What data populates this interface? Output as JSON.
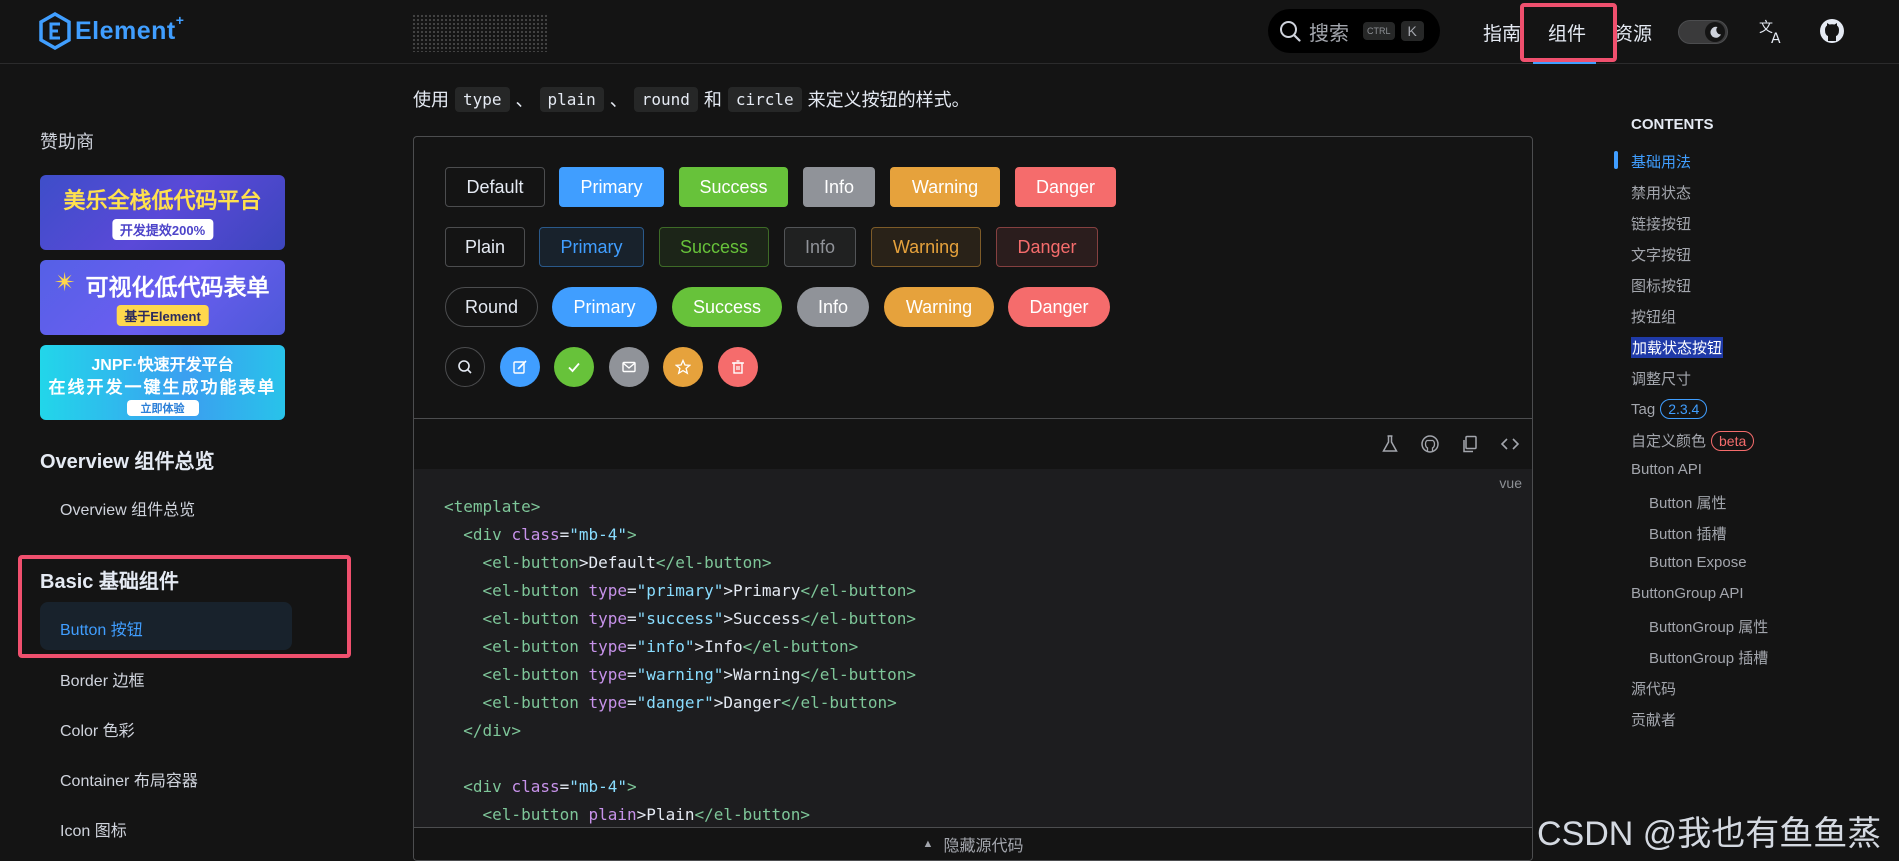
{
  "header": {
    "logo_text": "Element",
    "logo_sup": "+",
    "search_placeholder": "搜索",
    "search_kbd1": "CTRL",
    "search_kbd2": "K",
    "nav": [
      "指南",
      "组件",
      "资源"
    ]
  },
  "sidebar": {
    "sponsor_title": "赞助商",
    "ads": [
      {
        "main": "美乐全栈低代码平台",
        "pill": "开发提效200%"
      },
      {
        "main": "可视化低代码表单",
        "pill": "基于Element"
      },
      {
        "main": "JNPF·快速开发平台",
        "sub": "在线开发一键生成功能表单",
        "pill": "立即体验"
      }
    ],
    "group_overview": "Overview 组件总览",
    "link_overview": "Overview 组件总览",
    "group_basic": "Basic 基础组件",
    "links": [
      "Button 按钮",
      "Border 边框",
      "Color 色彩",
      "Container 布局容器",
      "Icon 图标"
    ]
  },
  "main": {
    "desc": {
      "prefix": "使用",
      "codes": [
        "type",
        "plain",
        "round",
        "circle"
      ],
      "sep": "、",
      "and": "和",
      "suffix": "来定义按钮的样式。"
    },
    "row1": [
      "Default",
      "Primary",
      "Success",
      "Info",
      "Warning",
      "Danger"
    ],
    "row2": [
      "Plain",
      "Primary",
      "Success",
      "Info",
      "Warning",
      "Danger"
    ],
    "row3": [
      "Round",
      "Primary",
      "Success",
      "Info",
      "Warning",
      "Danger"
    ],
    "circle_icons": [
      "search-icon",
      "edit-icon",
      "check-icon",
      "message-icon",
      "star-icon",
      "delete-icon"
    ],
    "toolbar_icons": [
      "flask-icon",
      "github-icon",
      "copy-icon",
      "code-icon"
    ],
    "code_lang": "vue",
    "code_lines": [
      [
        [
          "tg",
          "<template>"
        ]
      ],
      [
        [
          "",
          "  "
        ],
        [
          "tg",
          "<div "
        ],
        [
          "an",
          "class"
        ],
        [
          "",
          "="
        ],
        [
          "av",
          "\"mb-4\""
        ],
        [
          "tg",
          ">"
        ]
      ],
      [
        [
          "",
          "    "
        ],
        [
          "tg",
          "<el-button"
        ],
        [
          "",
          ">Default"
        ],
        [
          "tg",
          "</el-button>"
        ]
      ],
      [
        [
          "",
          "    "
        ],
        [
          "tg",
          "<el-button "
        ],
        [
          "an",
          "type"
        ],
        [
          "",
          "="
        ],
        [
          "av",
          "\"primary\""
        ],
        [
          "",
          ">Primary"
        ],
        [
          "tg",
          "</el-button>"
        ]
      ],
      [
        [
          "",
          "    "
        ],
        [
          "tg",
          "<el-button "
        ],
        [
          "an",
          "type"
        ],
        [
          "",
          "="
        ],
        [
          "av",
          "\"success\""
        ],
        [
          "",
          ">Success"
        ],
        [
          "tg",
          "</el-button>"
        ]
      ],
      [
        [
          "",
          "    "
        ],
        [
          "tg",
          "<el-button "
        ],
        [
          "an",
          "type"
        ],
        [
          "",
          "="
        ],
        [
          "av",
          "\"info\""
        ],
        [
          "",
          ">Info"
        ],
        [
          "tg",
          "</el-button>"
        ]
      ],
      [
        [
          "",
          "    "
        ],
        [
          "tg",
          "<el-button "
        ],
        [
          "an",
          "type"
        ],
        [
          "",
          "="
        ],
        [
          "av",
          "\"warning\""
        ],
        [
          "",
          ">Warning"
        ],
        [
          "tg",
          "</el-button>"
        ]
      ],
      [
        [
          "",
          "    "
        ],
        [
          "tg",
          "<el-button "
        ],
        [
          "an",
          "type"
        ],
        [
          "",
          "="
        ],
        [
          "av",
          "\"danger\""
        ],
        [
          "",
          ">Danger"
        ],
        [
          "tg",
          "</el-button>"
        ]
      ],
      [
        [
          "",
          "  "
        ],
        [
          "tg",
          "</div>"
        ]
      ],
      [
        [
          "",
          ""
        ]
      ],
      [
        [
          "",
          "  "
        ],
        [
          "tg",
          "<div "
        ],
        [
          "an",
          "class"
        ],
        [
          "",
          "="
        ],
        [
          "av",
          "\"mb-4\""
        ],
        [
          "tg",
          ">"
        ]
      ],
      [
        [
          "",
          "    "
        ],
        [
          "tg",
          "<el-button "
        ],
        [
          "an",
          "plain"
        ],
        [
          "",
          ">Plain"
        ],
        [
          "tg",
          "</el-button>"
        ]
      ]
    ],
    "hide_code": "隐藏源代码"
  },
  "toc": {
    "title": "CONTENTS",
    "items": [
      {
        "label": "基础用法",
        "sub": false,
        "state": "active"
      },
      {
        "label": "禁用状态",
        "sub": false
      },
      {
        "label": "链接按钮",
        "sub": false
      },
      {
        "label": "文字按钮",
        "sub": false
      },
      {
        "label": "图标按钮",
        "sub": false
      },
      {
        "label": "按钮组",
        "sub": false
      },
      {
        "label": "加载状态按钮",
        "sub": false,
        "state": "selected"
      },
      {
        "label": "调整尺寸",
        "sub": false
      },
      {
        "label": "Tag",
        "sub": false,
        "badge": "2.3.4",
        "badge_type": "tag"
      },
      {
        "label": "自定义颜色",
        "sub": false,
        "badge": "beta",
        "badge_type": "beta"
      },
      {
        "label": "Button API",
        "sub": false
      },
      {
        "label": "Button 属性",
        "sub": true
      },
      {
        "label": "Button 插槽",
        "sub": true
      },
      {
        "label": "Button Expose",
        "sub": true
      },
      {
        "label": "ButtonGroup API",
        "sub": false
      },
      {
        "label": "ButtonGroup 属性",
        "sub": true
      },
      {
        "label": "ButtonGroup 插槽",
        "sub": true
      },
      {
        "label": "源代码",
        "sub": false
      },
      {
        "label": "贡献者",
        "sub": false
      }
    ]
  },
  "watermark": "CSDN @我也有鱼鱼蒸",
  "colors": {
    "primary": "#409eff",
    "success": "#67c23a",
    "info": "#909399",
    "warning": "#e6a23c",
    "danger": "#f56c6c",
    "highlight": "#f0506e"
  }
}
